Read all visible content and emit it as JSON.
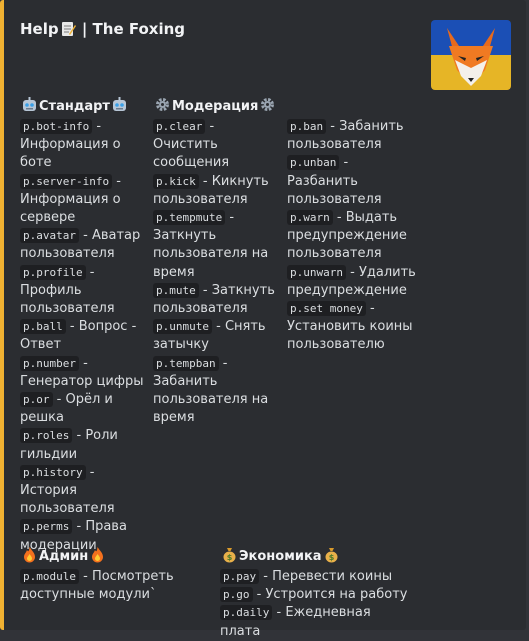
{
  "embed": {
    "title_text": "Help",
    "title_suffix": " | The Foxing",
    "title_icon": "memo-icon",
    "accent_color": "#f0b132",
    "thumbnail": "fox-logo"
  },
  "fields": {
    "standard": {
      "title": "Стандарт",
      "icon": "robot-icon",
      "items": [
        {
          "cmd": "p.bot-info",
          "desc": " - Информация о боте"
        },
        {
          "cmd": "p.server-info",
          "desc": " - Информация о сервере"
        },
        {
          "cmd": "p.avatar",
          "desc": " - Аватар пользователя"
        },
        {
          "cmd": "p.profile",
          "desc": " - Профиль пользователя"
        },
        {
          "cmd": "p.ball",
          "desc": " - Вопрос - Ответ"
        },
        {
          "cmd": "p.number",
          "desc": " - Генератор цифры"
        },
        {
          "cmd": "p.or",
          "desc": " - Орёл и решка"
        },
        {
          "cmd": "p.roles",
          "desc": " - Роли гильдии"
        },
        {
          "cmd": "p.history",
          "desc": " - История пользователя"
        },
        {
          "cmd": "p.perms",
          "desc": " - Права модерации"
        }
      ]
    },
    "moderation": {
      "title": "Модерация",
      "icon": "gear-icon",
      "items": [
        {
          "cmd": "p.clear",
          "desc": " - Очистить сообщения"
        },
        {
          "cmd": "p.kick",
          "desc": " - Кикнуть пользователя"
        },
        {
          "cmd": "p.tempmute",
          "desc": " - Заткнуть пользователя на время"
        },
        {
          "cmd": "p.mute",
          "desc": " - Заткнуть пользователя"
        },
        {
          "cmd": "p.unmute",
          "desc": " - Снять затычку"
        },
        {
          "cmd": "p.tempban",
          "desc": " - Забанить пользователя на время"
        }
      ]
    },
    "moderation2": {
      "items": [
        {
          "cmd": "p.ban",
          "desc": " - Забанить пользователя"
        },
        {
          "cmd": "p.unban",
          "desc": " - Разбанить пользователя"
        },
        {
          "cmd": "p.warn",
          "desc": " - Выдать предупреждение пользователя"
        },
        {
          "cmd": "p.unwarn",
          "desc": " - Удалить предупреждение"
        },
        {
          "cmd": "p.set money",
          "desc": " - Установить коины пользователю"
        }
      ]
    },
    "admin": {
      "title": "Админ",
      "icon": "fire-icon",
      "items": [
        {
          "cmd": "p.module",
          "desc": " - Посмотреть доступные модули`"
        }
      ]
    },
    "economy": {
      "title": "Экономика",
      "icon": "money-bag-icon",
      "items": [
        {
          "cmd": "p.pay",
          "desc": " - Перевести коины"
        },
        {
          "cmd": "p.go",
          "desc": " - Устроится на работу"
        },
        {
          "cmd": "p.daily",
          "desc": " - Ежедневная плата"
        }
      ]
    }
  }
}
